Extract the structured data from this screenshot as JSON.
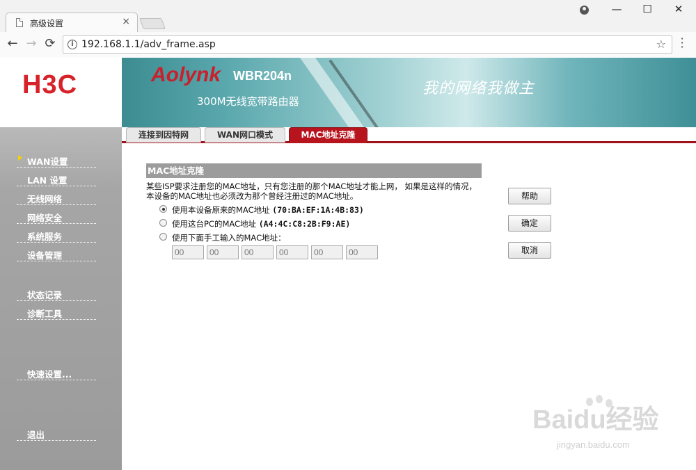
{
  "browser": {
    "tab_title": "高级设置",
    "url": "192.168.1.1/adv_frame.asp",
    "close_tab_glyph": "×",
    "window_controls": {
      "minimize": "—",
      "maximize": "☐",
      "close": "✕"
    },
    "nav": {
      "back": "←",
      "forward": "→",
      "reload": "⟳"
    },
    "star_glyph": "☆"
  },
  "header": {
    "logo": "H3C",
    "brand": "Aolynk",
    "model": "WBR204n",
    "subtitle": "300M无线宽带路由器",
    "slogan": "我的网络我做主"
  },
  "sidebar": {
    "items": [
      {
        "label": "WAN设置",
        "active": true
      },
      {
        "label": "LAN 设置"
      },
      {
        "label": "无线网络"
      },
      {
        "label": "网络安全"
      },
      {
        "label": "系统服务"
      },
      {
        "label": "设备管理"
      },
      {
        "label": "状态记录"
      },
      {
        "label": "诊断工具"
      },
      {
        "label": "快速设置..."
      },
      {
        "label": "退出"
      }
    ]
  },
  "tabs": [
    {
      "label": "连接到因特网"
    },
    {
      "label": "WAN网口模式"
    },
    {
      "label": "MAC地址克隆",
      "active": true
    }
  ],
  "mac_clone": {
    "title": "MAC地址克隆",
    "description": "某些ISP要求注册您的MAC地址，只有您注册的那个MAC地址才能上网， 如果是这样的情况，本设备的MAC地址也必须改为那个曾经注册过的MAC地址。",
    "options": [
      {
        "label": "使用本设备原来的MAC地址",
        "mac": "(70:BA:EF:1A:4B:83)",
        "checked": true
      },
      {
        "label": "使用这台PC的MAC地址",
        "mac": "(A4:4C:C8:2B:F9:AE)",
        "checked": false
      },
      {
        "label": "使用下面手工输入的MAC地址：",
        "mac": "",
        "checked": false
      }
    ],
    "manual_fields": [
      "00",
      "00",
      "00",
      "00",
      "00",
      "00"
    ]
  },
  "buttons": {
    "help": "帮助",
    "ok": "确定",
    "cancel": "取消"
  },
  "watermark": {
    "main": "Baidu经验",
    "sub": "jingyan.baidu.com"
  },
  "colors": {
    "brand_red": "#d8222a",
    "tab_active": "#b7141e",
    "sidebar_gray": "#a6a6a6",
    "section_header_gray": "#9c9c9c"
  }
}
